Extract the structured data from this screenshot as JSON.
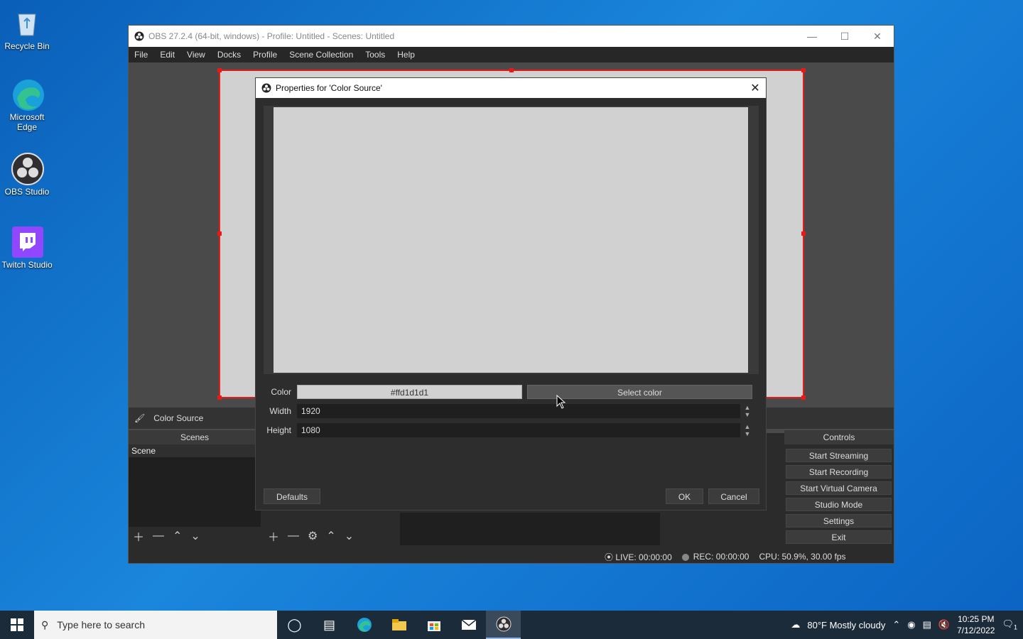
{
  "desktop": {
    "icons": [
      {
        "label": "Recycle Bin"
      },
      {
        "label": "Microsoft Edge"
      },
      {
        "label": "OBS Studio"
      },
      {
        "label": "Twitch Studio"
      }
    ]
  },
  "obs": {
    "title": "OBS 27.2.4 (64-bit, windows) - Profile: Untitled - Scenes: Untitled",
    "menu": [
      "File",
      "Edit",
      "View",
      "Docks",
      "Profile",
      "Scene Collection",
      "Tools",
      "Help"
    ],
    "preview_color": "#d1d1d1",
    "selected_source": "Color Source",
    "scenes_title": "Scenes",
    "scenes": [
      "Scene"
    ],
    "controls_title": "Controls",
    "controls": [
      "Start Streaming",
      "Start Recording",
      "Start Virtual Camera",
      "Studio Mode",
      "Settings",
      "Exit"
    ],
    "status": {
      "live": "LIVE: 00:00:00",
      "rec": "REC: 00:00:00",
      "cpu": "CPU: 50.9%, 30.00 fps"
    }
  },
  "dialog": {
    "title": "Properties for 'Color Source'",
    "color_label": "Color",
    "color_value": "#ffd1d1d1",
    "select_color_label": "Select color",
    "width_label": "Width",
    "width_value": "1920",
    "height_label": "Height",
    "height_value": "1080",
    "defaults_label": "Defaults",
    "ok_label": "OK",
    "cancel_label": "Cancel"
  },
  "taskbar": {
    "search_placeholder": "Type here to search",
    "weather": "80°F  Mostly cloudy",
    "time": "10:25 PM",
    "date": "7/12/2022",
    "notifications": "1"
  }
}
